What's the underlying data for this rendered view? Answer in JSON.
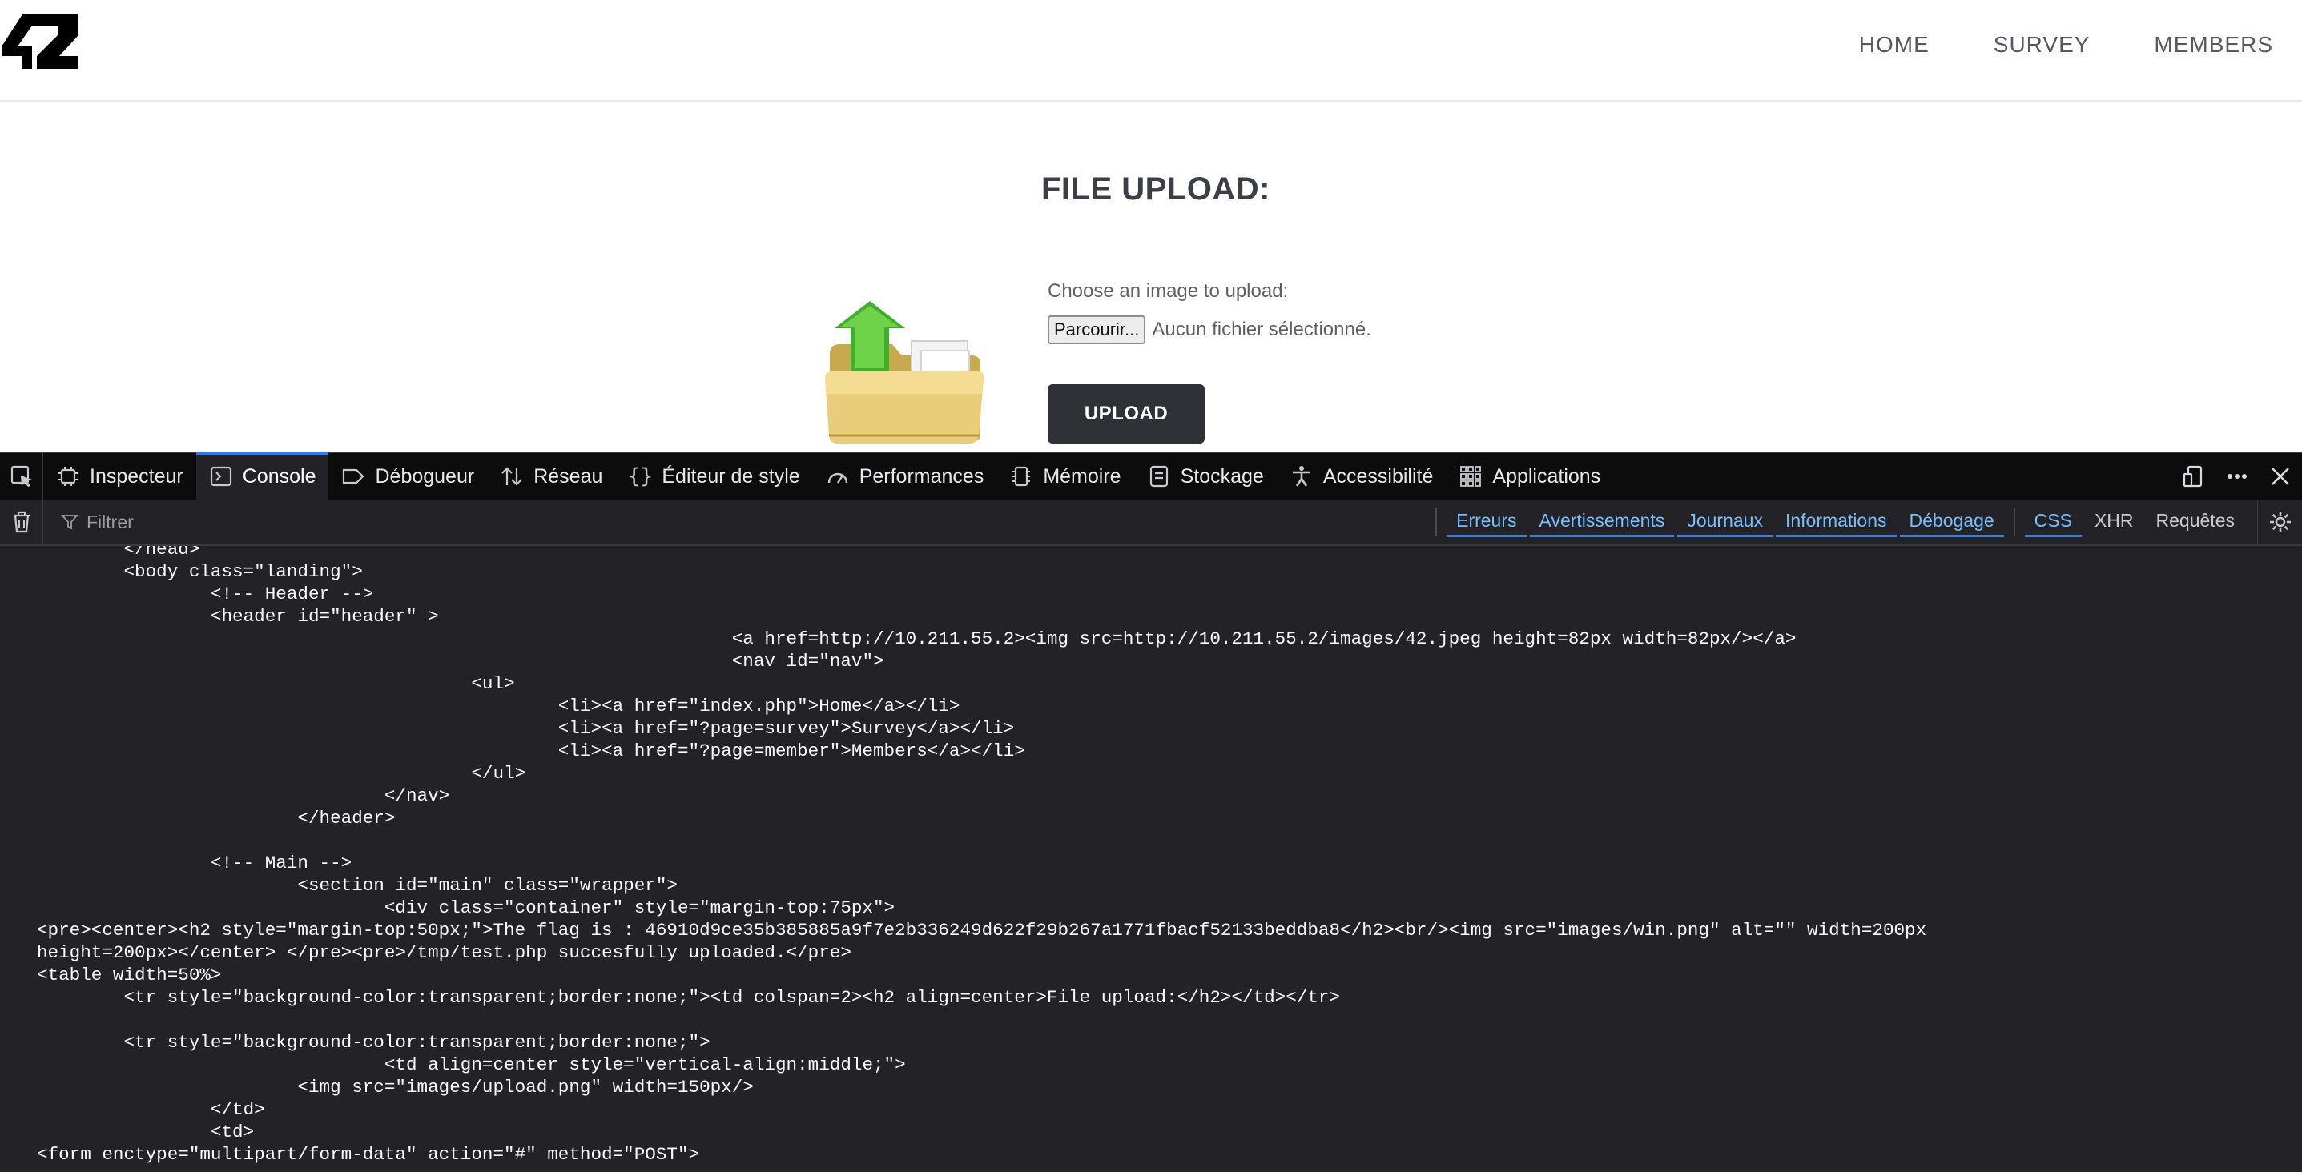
{
  "header": {
    "logo_text": "42",
    "nav": [
      "HOME",
      "SURVEY",
      "MEMBERS"
    ]
  },
  "main": {
    "title": "FILE UPLOAD:",
    "choose_label": "Choose an image to upload:",
    "browse_label": "Parcourir...",
    "file_status": "Aucun fichier sélectionné.",
    "upload_label": "UPLOAD",
    "image_icon": "upload-folder-icon"
  },
  "devtools": {
    "tabs": [
      {
        "label": "Inspecteur",
        "icon": "inspector-icon"
      },
      {
        "label": "Console",
        "icon": "console-icon",
        "active": true
      },
      {
        "label": "Débogueur",
        "icon": "debugger-icon"
      },
      {
        "label": "Réseau",
        "icon": "network-icon"
      },
      {
        "label": "Éditeur de style",
        "icon": "style-editor-icon"
      },
      {
        "label": "Performances",
        "icon": "performance-icon"
      },
      {
        "label": "Mémoire",
        "icon": "memory-icon"
      },
      {
        "label": "Stockage",
        "icon": "storage-icon"
      },
      {
        "label": "Accessibilité",
        "icon": "accessibility-icon"
      },
      {
        "label": "Applications",
        "icon": "applications-icon"
      }
    ],
    "filter_placeholder": "Filtrer",
    "levels": [
      "Erreurs",
      "Avertissements",
      "Journaux",
      "Informations",
      "Débogage"
    ],
    "types": [
      {
        "label": "CSS",
        "active": true
      },
      {
        "label": "XHR",
        "active": false
      },
      {
        "label": "Requêtes",
        "active": false
      }
    ],
    "accent_color": "#2f7bf5",
    "console_lines": [
      "        </head>",
      "        <body class=\"landing\">",
      "                <!-- Header -->",
      "                <header id=\"header\" >",
      "                                                                <a href=http://10.211.55.2><img src=http://10.211.55.2/images/42.jpeg height=82px width=82px/></a>",
      "                                                                <nav id=\"nav\">",
      "                                        <ul>",
      "                                                <li><a href=\"index.php\">Home</a></li>",
      "                                                <li><a href=\"?page=survey\">Survey</a></li>",
      "                                                <li><a href=\"?page=member\">Members</a></li>",
      "                                        </ul>",
      "                                </nav>",
      "                        </header>",
      "",
      "                <!-- Main -->",
      "                        <section id=\"main\" class=\"wrapper\">",
      "                                <div class=\"container\" style=\"margin-top:75px\">",
      "<pre><center><h2 style=\"margin-top:50px;\">The flag is : 46910d9ce35b385885a9f7e2b336249d622f29b267a1771fbacf52133beddba8</h2><br/><img src=\"images/win.png\" alt=\"\" width=200px",
      "height=200px></center> </pre><pre>/tmp/test.php succesfully uploaded.</pre>",
      "<table width=50%>",
      "        <tr style=\"background-color:transparent;border:none;\"><td colspan=2><h2 align=center>File upload:</h2></td></tr>",
      "",
      "        <tr style=\"background-color:transparent;border:none;\">",
      "                                <td align=center style=\"vertical-align:middle;\">",
      "                        <img src=\"images/upload.png\" width=150px/>",
      "                </td>",
      "                <td>",
      "<form enctype=\"multipart/form-data\" action=\"#\" method=\"POST\">"
    ]
  }
}
